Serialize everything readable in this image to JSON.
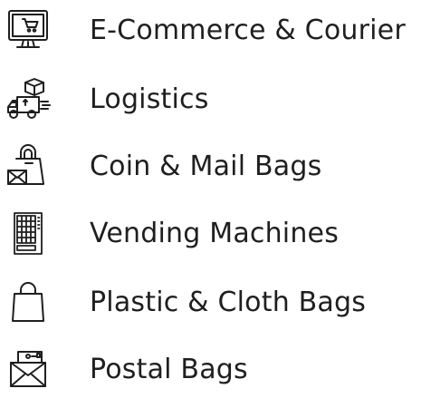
{
  "colors": {
    "text": "#1f1f1f",
    "icon_stroke": "#1f1f1f",
    "background": "#ffffff"
  },
  "items": [
    {
      "label": "E-Commerce & Courier",
      "icon": "monitor-shopping-cart-icon"
    },
    {
      "label": "Logistics",
      "icon": "delivery-truck-icon"
    },
    {
      "label": "Coin & Mail Bags",
      "icon": "bag-envelope-icon"
    },
    {
      "label": "Vending Machines",
      "icon": "vending-machine-icon"
    },
    {
      "label": "Plastic & Cloth Bags",
      "icon": "shopping-bag-icon"
    },
    {
      "label": "Postal Bags",
      "icon": "postal-envelope-icon"
    }
  ]
}
